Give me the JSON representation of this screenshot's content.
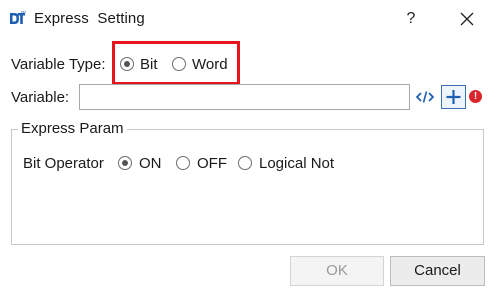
{
  "window": {
    "title": "Express  Setting",
    "logo_text": "DT",
    "help_label": "?"
  },
  "variable_type": {
    "label": "Variable Type:",
    "options": [
      {
        "label": "Bit",
        "checked": true
      },
      {
        "label": "Word",
        "checked": false
      }
    ]
  },
  "variable": {
    "label": "Variable:",
    "value": "",
    "warning_symbol": "!"
  },
  "express_param": {
    "title": "Express Param",
    "bit_operator": {
      "label": "Bit Operator",
      "options": [
        {
          "label": "ON",
          "checked": true
        },
        {
          "label": "OFF",
          "checked": false
        },
        {
          "label": "Logical Not",
          "checked": false
        }
      ]
    }
  },
  "buttons": {
    "ok_label": "OK",
    "cancel_label": "Cancel"
  },
  "colors": {
    "highlight": "#e8141c",
    "logo_blue": "#1e5fb4",
    "warning_red": "#d9262c"
  }
}
